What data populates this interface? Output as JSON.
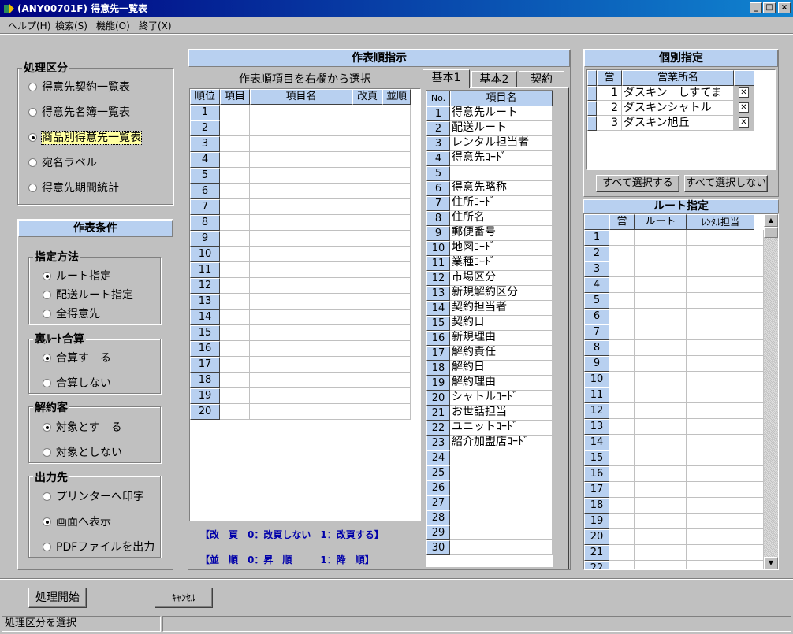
{
  "window": {
    "title": "(ANY00701F) 得意先一覧表",
    "min": "_",
    "max": "□",
    "close": "×"
  },
  "menu": [
    "ヘルプ(H)",
    "検索(S)",
    "機能(O)",
    "終了(X)"
  ],
  "shori": {
    "title": "処理区分",
    "options": [
      "得意先契約一覧表",
      "得意先名簿一覧表",
      "商品別得意先一覧表",
      "宛名ラベル",
      "得意先期間統計"
    ],
    "selected": 2
  },
  "conditions": {
    "title": "作表条件",
    "method": {
      "title": "指定方法",
      "options": [
        "ルート指定",
        "配送ルート指定",
        "全得意先"
      ],
      "selected": 0
    },
    "ura": {
      "title": "裏ﾙｰﾄ合算",
      "options": [
        "合算す　る",
        "合算しない"
      ],
      "selected": 0
    },
    "kaiyaku": {
      "title": "解約客",
      "options": [
        "対象とす　る",
        "対象としない"
      ],
      "selected": 0
    },
    "output": {
      "title": "出力先",
      "options": [
        "プリンターへ印字",
        "画面へ表示",
        "PDFファイルを出力"
      ],
      "selected": 1
    }
  },
  "order": {
    "title": "作表順指示",
    "subtitle": "作表順項目を右欄から選択",
    "headers": [
      "順位",
      "項目",
      "項目名",
      "改頁",
      "並順"
    ],
    "rows": [
      "1",
      "2",
      "3",
      "4",
      "5",
      "6",
      "7",
      "8",
      "9",
      "10",
      "11",
      "12",
      "13",
      "14",
      "15",
      "16",
      "17",
      "18",
      "19",
      "20"
    ],
    "legend1": "【改　頁　0：改頁しない　1：改頁する】",
    "legend2": "【並　順　0：昇　順　　　1：降　順】"
  },
  "tabs": [
    "基本1",
    "基本2",
    "契約"
  ],
  "items": {
    "headers": [
      "No.",
      "項目名"
    ],
    "rows": [
      [
        "1",
        "得意先ルート"
      ],
      [
        "2",
        "配送ルート"
      ],
      [
        "3",
        "レンタル担当者"
      ],
      [
        "4",
        "得意先ｺｰﾄﾞ"
      ],
      [
        "5",
        ""
      ],
      [
        "6",
        "得意先略称"
      ],
      [
        "7",
        "住所ｺｰﾄﾞ"
      ],
      [
        "8",
        "住所名"
      ],
      [
        "9",
        "郵便番号"
      ],
      [
        "10",
        "地図ｺｰﾄﾞ"
      ],
      [
        "11",
        "業種ｺｰﾄﾞ"
      ],
      [
        "12",
        "市場区分"
      ],
      [
        "13",
        "新規解約区分"
      ],
      [
        "14",
        "契約担当者"
      ],
      [
        "15",
        "契約日"
      ],
      [
        "16",
        "新規理由"
      ],
      [
        "17",
        "解約責任"
      ],
      [
        "18",
        "解約日"
      ],
      [
        "19",
        "解約理由"
      ],
      [
        "20",
        "シャトルｺｰﾄﾞ"
      ],
      [
        "21",
        "お世話担当"
      ],
      [
        "22",
        "ユニットｺｰﾄﾞ"
      ],
      [
        "23",
        "紹介加盟店ｺｰﾄﾞ"
      ],
      [
        "24",
        ""
      ],
      [
        "25",
        ""
      ],
      [
        "26",
        ""
      ],
      [
        "27",
        ""
      ],
      [
        "28",
        ""
      ],
      [
        "29",
        ""
      ],
      [
        "30",
        ""
      ]
    ]
  },
  "kobetsu": {
    "title": "個別指定",
    "headers": [
      "営",
      "営業所名"
    ],
    "rows": [
      [
        "1",
        "ダスキン　しすてま",
        "✕"
      ],
      [
        "2",
        "ダスキンシャトル",
        "✕"
      ],
      [
        "3",
        "ダスキン旭丘",
        "✕"
      ]
    ],
    "select_all": "すべて選択する",
    "select_none": "すべて選択しない"
  },
  "route": {
    "title": "ルート指定",
    "headers": [
      "営",
      "ルート",
      "ﾚﾝﾀﾙ担当"
    ],
    "rows": [
      "1",
      "2",
      "3",
      "4",
      "5",
      "6",
      "7",
      "8",
      "9",
      "10",
      "11",
      "12",
      "13",
      "14",
      "15",
      "16",
      "17",
      "18",
      "19",
      "20",
      "21",
      "22"
    ]
  },
  "buttons": {
    "start": "処理開始",
    "cancel": "ｷｬﾝｾﾙ"
  },
  "status": "処理区分を選択"
}
